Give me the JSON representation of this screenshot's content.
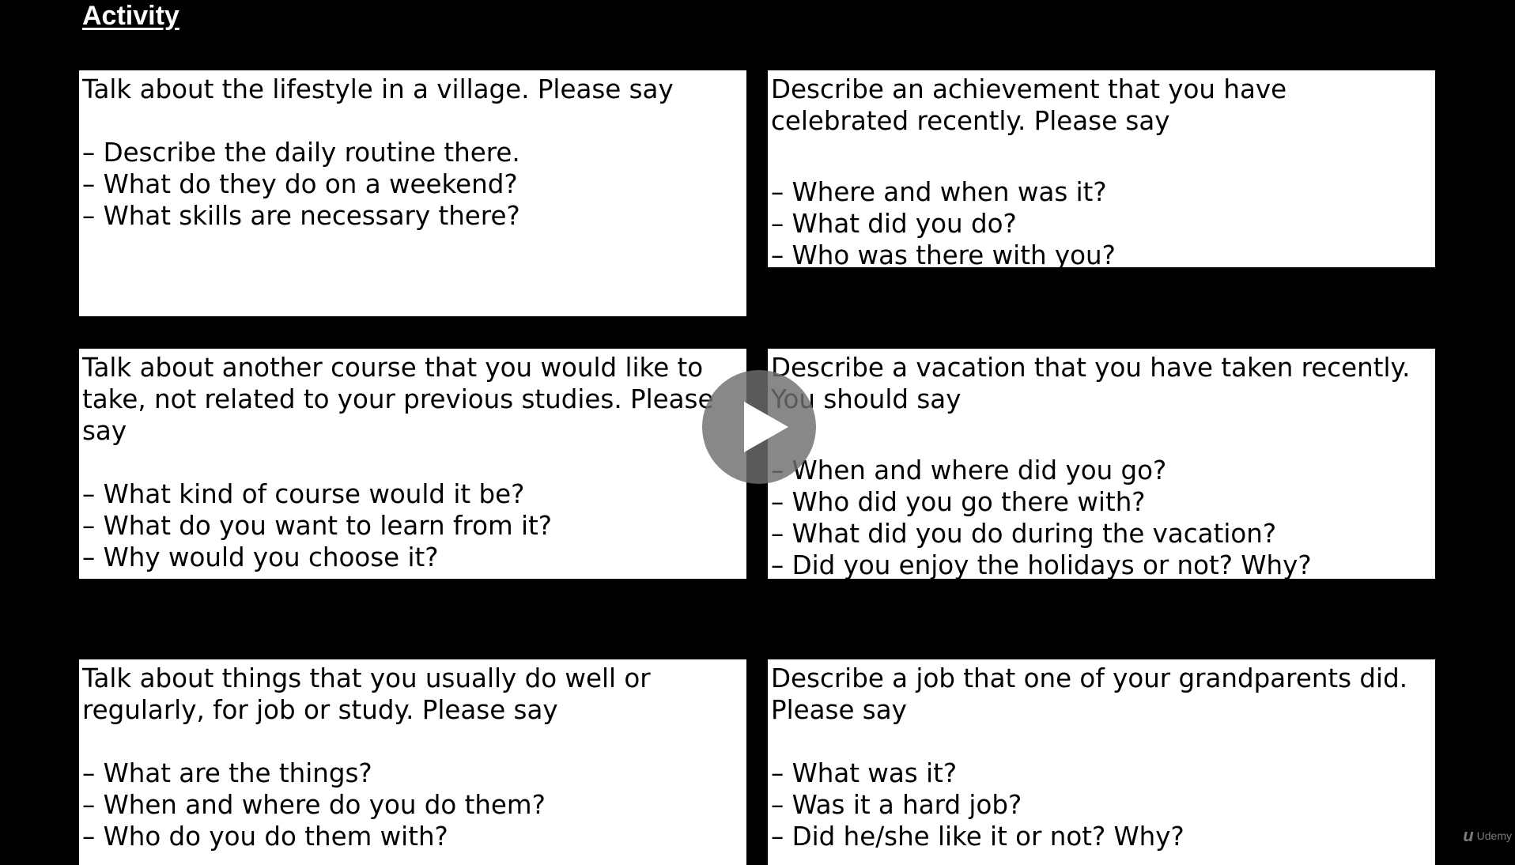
{
  "title": "Activity",
  "cards": [
    {
      "prompt": "Talk about the lifestyle in a village. Please say",
      "items": [
        "– Describe the daily routine there.",
        "– What do they do on a weekend?",
        "– What skills are necessary there?"
      ]
    },
    {
      "prompt": "Describe an achievement that you have celebrated recently. Please say",
      "items": [
        "– Where and when was it?",
        "– What did you do?",
        "– Who was there with you?"
      ]
    },
    {
      "prompt": "Talk about another course that you would like to take, not related to your previous studies. Please say",
      "items": [
        "– What kind of course would it be?",
        "– What do you want to learn from it?",
        "– Why would you choose it?"
      ]
    },
    {
      "prompt": "Describe a vacation that you have taken recently. You should say",
      "items": [
        "– When and where did you go?",
        "– Who did you go there with?",
        "– What did you do during the vacation?",
        "– Did you enjoy the holidays or not? Why?"
      ]
    },
    {
      "prompt": "Talk about things that you usually do well or regularly, for job or study. Please say",
      "items": [
        "– What are the things?",
        "– When and where do you do them?",
        "– Who do you do them with?"
      ]
    },
    {
      "prompt": "Describe a job that one of your grandparents did. Please say",
      "items": [
        "– What was it?",
        "– Was it a hard job?",
        "– Did he/she like it or not? Why?"
      ]
    }
  ],
  "player": {
    "play_icon": "play-icon"
  },
  "watermark": {
    "logo": "u",
    "text": "Udemy"
  }
}
